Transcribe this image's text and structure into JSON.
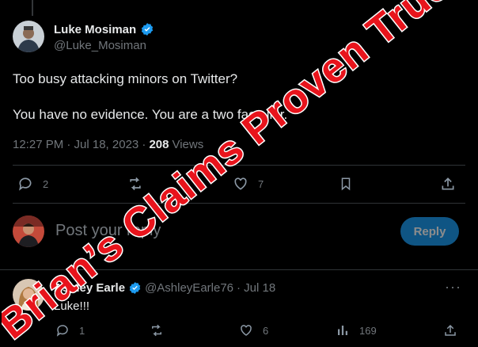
{
  "tweet": {
    "author_name": "Luke Mosiman",
    "author_handle": "@Luke_Mosiman",
    "line1": "Too busy attacking minors on Twitter?",
    "line2": "You have no evidence. You are a two face liar.",
    "timestamp": "12:27 PM · Jul 18, 2023 ·",
    "views_count": "208",
    "views_label": "Views",
    "actions": {
      "replies": "2",
      "retweets": "",
      "likes": "7"
    }
  },
  "composer": {
    "placeholder": "Post your reply",
    "reply_label": "Reply"
  },
  "reply_post": {
    "author_name": "Ashley Earle",
    "author_handle": "@AshleyEarle76",
    "date": "· Jul 18",
    "text": "Luke!!!",
    "actions": {
      "replies": "1",
      "retweets": "",
      "likes": "6",
      "views": "169"
    }
  },
  "overlay": {
    "text": "Brian’s Claims Proven True",
    "fill": "#e8141c",
    "stroke": "#ffffff"
  },
  "colors": {
    "accent": "#1d9bf0",
    "background": "#000000",
    "muted": "#71767b"
  },
  "icons": [
    "verified-badge-icon",
    "reply-icon",
    "retweet-icon",
    "like-icon",
    "bookmark-icon",
    "share-icon",
    "views-icon",
    "more-icon"
  ]
}
